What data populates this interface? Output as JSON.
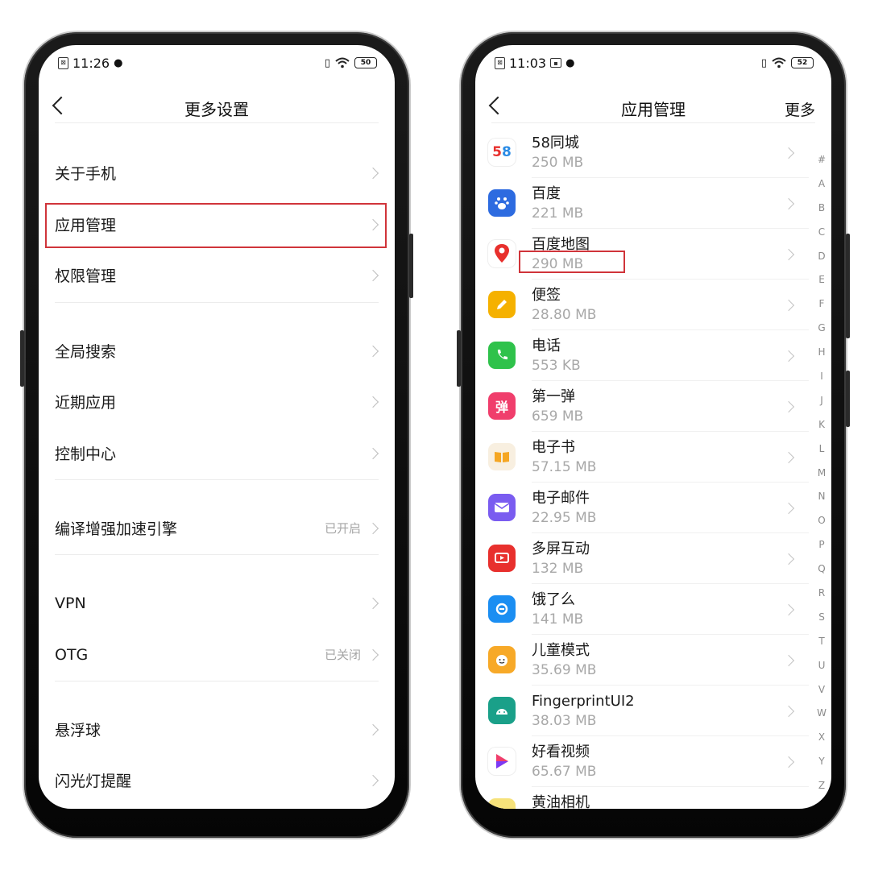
{
  "left_phone": {
    "status": {
      "time": "11:26",
      "battery": "50"
    },
    "nav": {
      "title": "更多设置"
    },
    "rows": [
      {
        "label": "关于手机",
        "status": ""
      },
      {
        "label": "应用管理",
        "status": ""
      },
      {
        "label": "权限管理",
        "status": ""
      },
      {
        "label": "全局搜索",
        "status": ""
      },
      {
        "label": "近期应用",
        "status": ""
      },
      {
        "label": "控制中心",
        "status": ""
      },
      {
        "label": "编译增强加速引擎",
        "status": "已开启"
      },
      {
        "label": "VPN",
        "status": ""
      },
      {
        "label": "OTG",
        "status": "已关闭"
      },
      {
        "label": "悬浮球",
        "status": ""
      },
      {
        "label": "闪光灯提醒",
        "status": ""
      }
    ],
    "highlighted_row": "应用管理"
  },
  "right_phone": {
    "status": {
      "time": "11:03",
      "battery": "52"
    },
    "nav": {
      "title": "应用管理",
      "more": "更多"
    },
    "apps": [
      {
        "name": "58同城",
        "size": "250 MB",
        "icon": "58-logo-icon",
        "color": "#ffffff"
      },
      {
        "name": "百度",
        "size": "221 MB",
        "icon": "baidu-paw-icon",
        "color": "#2d6be0"
      },
      {
        "name": "百度地图",
        "size": "290 MB",
        "icon": "map-pin-icon",
        "color": "#ffffff"
      },
      {
        "name": "便签",
        "size": "28.80 MB",
        "icon": "pencil-icon",
        "color": "#f5b100"
      },
      {
        "name": "电话",
        "size": "553 KB",
        "icon": "phone-icon",
        "color": "#2fc24b"
      },
      {
        "name": "第一弹",
        "size": "659 MB",
        "icon": "dan-icon",
        "color": "#f03e6c"
      },
      {
        "name": "电子书",
        "size": "57.15 MB",
        "icon": "book-icon",
        "color": "#f8efe0"
      },
      {
        "name": "电子邮件",
        "size": "22.95 MB",
        "icon": "mail-icon",
        "color": "#7a5cf0"
      },
      {
        "name": "多屏互动",
        "size": "132 MB",
        "icon": "cast-icon",
        "color": "#e8302d"
      },
      {
        "name": "饿了么",
        "size": "141 MB",
        "icon": "eleme-icon",
        "color": "#1b8ef2"
      },
      {
        "name": "儿童模式",
        "size": "35.69 MB",
        "icon": "kid-face-icon",
        "color": "#f7a928"
      },
      {
        "name": "FingerprintUI2",
        "size": "38.03 MB",
        "icon": "android-icon",
        "color": "#1aa089"
      },
      {
        "name": "好看视频",
        "size": "65.67 MB",
        "icon": "play-icon",
        "color": "#ffffff"
      },
      {
        "name": "黄油相机",
        "size": "",
        "icon": "butter-camera-icon",
        "color": "#f6e27a"
      }
    ],
    "highlighted_size": "290 MB",
    "alphabet": [
      "#",
      "A",
      "B",
      "C",
      "D",
      "E",
      "F",
      "G",
      "H",
      "I",
      "J",
      "K",
      "L",
      "M",
      "N",
      "O",
      "P",
      "Q",
      "R",
      "S",
      "T",
      "U",
      "V",
      "W",
      "X",
      "Y",
      "Z"
    ]
  }
}
